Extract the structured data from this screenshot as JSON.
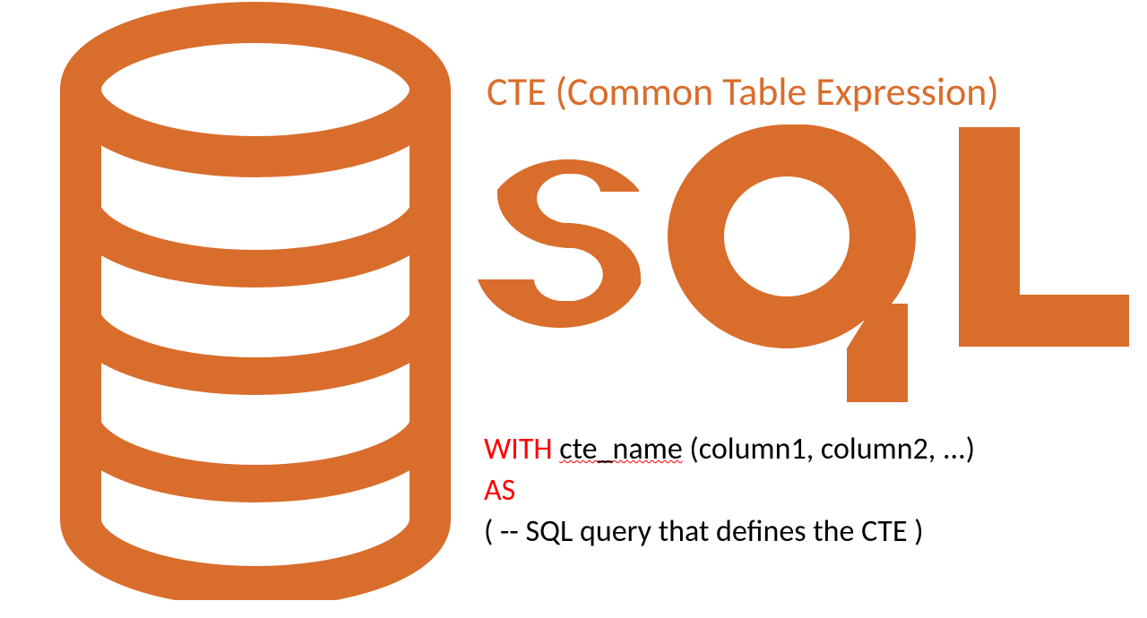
{
  "title": "CTE (Common Table Expression)",
  "sql_logo_text": "SQL",
  "code": {
    "with_keyword": "WITH",
    "cte_identifier": "cte_name",
    "columns_part": " (column1, column2, ...)",
    "as_keyword": "AS",
    "body_part": "(  -- SQL query that defines the CTE  )"
  },
  "colors": {
    "brand_orange": "#d96d2c",
    "keyword_red": "#ff0000",
    "text_black": "#000000"
  }
}
